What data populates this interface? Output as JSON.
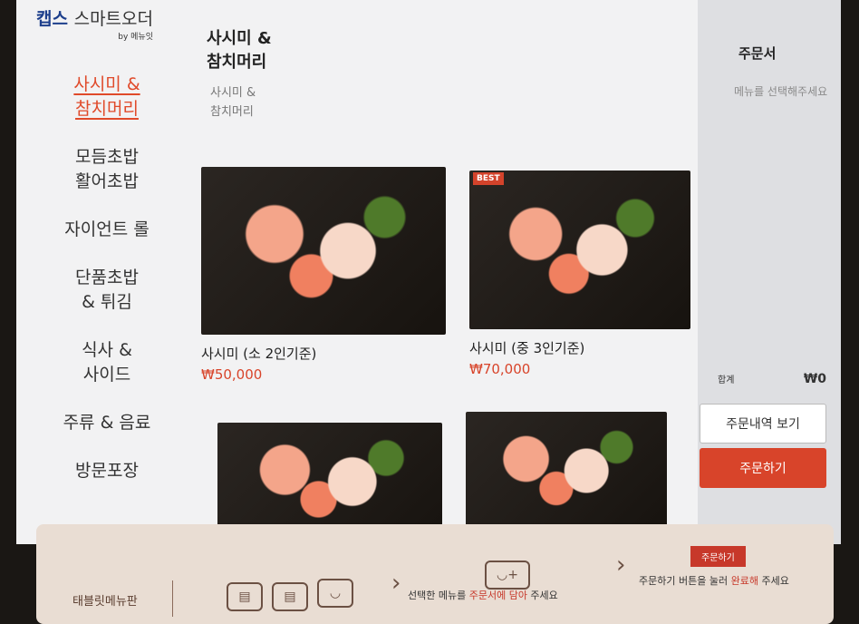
{
  "logo": {
    "brand": "캡스",
    "product": "스마트오더",
    "by": "by 메뉴잇"
  },
  "sidebar": {
    "items": [
      {
        "label": "사시미 &\n참치머리",
        "active": true
      },
      {
        "label": "모듬초밥\n활어초밥"
      },
      {
        "label": "자이언트 롤"
      },
      {
        "label": "단품초밥\n& 튀김"
      },
      {
        "label": "식사 &\n사이드"
      },
      {
        "label": "주류 & 음료"
      },
      {
        "label": "방문포장"
      }
    ]
  },
  "category": {
    "title": "사시미 &\n참치머리",
    "subtitle": "사시미 &\n참치머리"
  },
  "menu": [
    {
      "name": "사시미 (소 2인기준)",
      "price": "₩50,000",
      "badge": ""
    },
    {
      "name": "사시미 (중 3인기준)",
      "price": "₩70,000",
      "badge": "BEST"
    },
    {
      "name": "",
      "price": "",
      "badge": ""
    },
    {
      "name": "",
      "price": "",
      "badge": ""
    }
  ],
  "order": {
    "title": "주문서",
    "hint": "메뉴를 선택해주세요",
    "total_label": "합계",
    "total_value": "₩0",
    "history_button": "주문내역 보기",
    "order_button": "주문하기"
  },
  "guide": {
    "title": "태블릿메뉴판",
    "step2_prefix": "선택한 메뉴를 ",
    "step2_em": "주문서에 담아",
    "step2_suffix": " 주세요",
    "step3_prefix": "주문하기 버튼을 눌러 ",
    "step3_em": "완료해",
    "step3_suffix": " 주세요",
    "order_sample": "주문하기"
  },
  "colors": {
    "accent": "#d8442a",
    "brand": "#1d3f8c"
  }
}
